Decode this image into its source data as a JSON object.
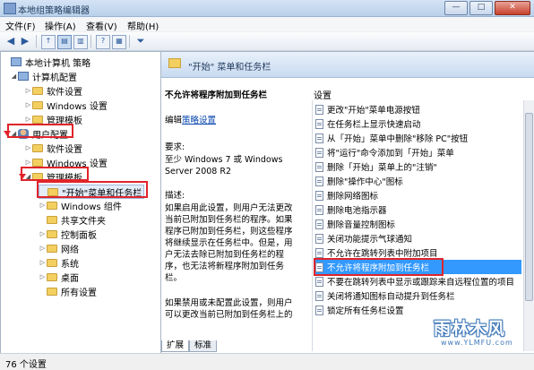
{
  "window": {
    "title": "本地组策略编辑器",
    "minimize": "—",
    "maximize": "□",
    "close": "✕"
  },
  "menu": [
    "文件(F)",
    "操作(A)",
    "查看(V)",
    "帮助(H)"
  ],
  "toolbar": {
    "back": "◀",
    "forward": "▶",
    "help": "?"
  },
  "tree": [
    {
      "label": "本地计算机 策略",
      "icon": "computer-policy-icon",
      "arrow": ""
    },
    {
      "label": "计算机配置",
      "icon": "computer-icon",
      "arrow": "◢"
    },
    {
      "label": "软件设置",
      "icon": "folder-icon",
      "arrow": "▷"
    },
    {
      "label": "Windows 设置",
      "icon": "folder-icon",
      "arrow": "▷"
    },
    {
      "label": "管理模板",
      "icon": "folder-icon",
      "arrow": "▷"
    },
    {
      "label": "用户配置",
      "icon": "user-icon",
      "arrow": "◢"
    },
    {
      "label": "软件设置",
      "icon": "folder-icon",
      "arrow": "▷"
    },
    {
      "label": "Windows 设置",
      "icon": "folder-icon",
      "arrow": "▷"
    },
    {
      "label": "管理模板",
      "icon": "folder-icon",
      "arrow": "◢"
    },
    {
      "label": "\"开始\"菜单和任务栏",
      "icon": "folder-icon",
      "arrow": ""
    },
    {
      "label": "Windows 组件",
      "icon": "folder-icon",
      "arrow": "▷"
    },
    {
      "label": "共享文件夹",
      "icon": "folder-icon",
      "arrow": ""
    },
    {
      "label": "控制面板",
      "icon": "folder-icon",
      "arrow": "▷"
    },
    {
      "label": "网络",
      "icon": "folder-icon",
      "arrow": "▷"
    },
    {
      "label": "系统",
      "icon": "folder-icon",
      "arrow": "▷"
    },
    {
      "label": "桌面",
      "icon": "folder-icon",
      "arrow": "▷"
    },
    {
      "label": "所有设置",
      "icon": "folder-icon",
      "arrow": ""
    }
  ],
  "header": {
    "title": "\"开始\" 菜单和任务栏"
  },
  "description": {
    "policy_title": "不允许将程序附加到任务栏",
    "edit_prefix": "编辑",
    "edit_link": "策略设置",
    "requirements_label": "要求:",
    "requirements_lines": [
      "至少 Windows 7 或 Windows",
      "Server 2008 R2"
    ],
    "desc_label": "描述:",
    "desc_lines": [
      "如果启用此设置，则用户无法更改",
      "当前已附加到任务栏的程序。如果",
      "程序已附加到任务栏，则这些程序",
      "将继续显示在任务栏中。但是，用",
      "户无法去除已附加到任务栏的程",
      "序，也无法将新程序附加到任务",
      "栏。"
    ],
    "desc2_lines": [
      "如果禁用或未配置此设置，则用户",
      "可以更改当前已附加到任务栏上的"
    ]
  },
  "settings": {
    "header": "设置",
    "items": [
      "更改\"开始\"菜单电源按钮",
      "在任务栏上显示快速启动",
      "从「开始」菜单中删除\"移除 PC\"按钮",
      "将\"运行\"命令添加到「开始」菜单",
      "删除「开始」菜单上的\"注销\"",
      "删除\"操作中心\"图标",
      "删除网络图标",
      "删除电池指示器",
      "删除音量控制图标",
      "关闭功能提示气球通知",
      "不允许在跳转列表中附加项目",
      "不允许将程序附加到任务栏",
      "不要在跳转列表中显示或跟踪来自远程位置的项目",
      "关闭将通知图标自动提升到任务栏",
      "锁定所有任务栏设置"
    ],
    "selected_index": 11
  },
  "tabs": [
    "扩展",
    "标准"
  ],
  "status": {
    "text": "76 个设置"
  },
  "watermark": {
    "text": "雨林木风",
    "url": "www.YLMFU.com"
  }
}
